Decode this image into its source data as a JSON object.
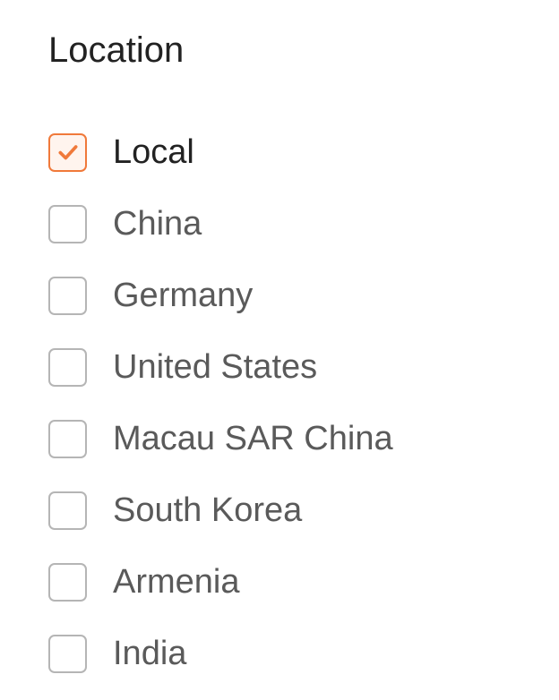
{
  "filter": {
    "title": "Location",
    "accent_color": "#f0793a",
    "options": [
      {
        "label": "Local",
        "checked": true
      },
      {
        "label": "China",
        "checked": false
      },
      {
        "label": "Germany",
        "checked": false
      },
      {
        "label": "United States",
        "checked": false
      },
      {
        "label": "Macau SAR China",
        "checked": false
      },
      {
        "label": "South Korea",
        "checked": false
      },
      {
        "label": "Armenia",
        "checked": false
      },
      {
        "label": "India",
        "checked": false
      }
    ]
  }
}
